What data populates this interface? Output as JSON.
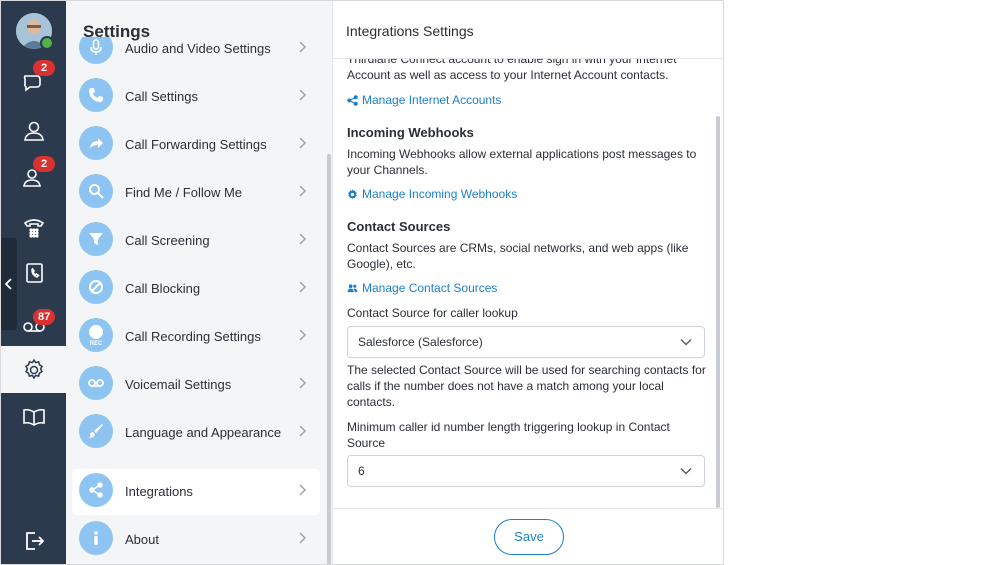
{
  "rail": {
    "chat_badge": "2",
    "contacts_badge": "2",
    "voicemail_badge": "87"
  },
  "menu": {
    "title": "Settings",
    "items": [
      {
        "label": "Audio and Video Settings",
        "icon": "microphone-icon"
      },
      {
        "label": "Call Settings",
        "icon": "phone-icon"
      },
      {
        "label": "Call Forwarding Settings",
        "icon": "forward-arrow-icon"
      },
      {
        "label": "Find Me / Follow Me",
        "icon": "search-icon"
      },
      {
        "label": "Call Screening",
        "icon": "funnel-icon"
      },
      {
        "label": "Call Blocking",
        "icon": "block-icon"
      },
      {
        "label": "Call Recording Settings",
        "icon": "record-icon",
        "icon_text": "REC"
      },
      {
        "label": "Voicemail Settings",
        "icon": "voicemail-icon"
      },
      {
        "label": "Language and Appearance",
        "icon": "brush-icon"
      },
      {
        "label": "Integrations",
        "icon": "share-icon",
        "selected": true
      },
      {
        "label": "About",
        "icon": "info-icon"
      }
    ]
  },
  "panel": {
    "title": "Integrations Settings",
    "intro_text": "Thirdlane Connect account to enable sign in with your Internet Account as well as access to your Internet Account contacts.",
    "manage_internet_accounts": "Manage Internet Accounts",
    "webhooks": {
      "heading": "Incoming Webhooks",
      "description": "Incoming Webhooks allow external applications post messages to your Channels.",
      "link": "Manage Incoming Webhooks"
    },
    "contact_sources": {
      "heading": "Contact Sources",
      "description": "Contact Sources are CRMs, social networks, and web apps (like Google), etc.",
      "link": "Manage Contact Sources",
      "lookup_label": "Contact Source for caller lookup",
      "lookup_value": "Salesforce (Salesforce)",
      "lookup_help": "The selected Contact Source will be used for searching contacts for calls if the number does not have a match among your local contacts.",
      "min_length_label": "Minimum caller id number length triggering lookup in Contact Source",
      "min_length_value": "6"
    },
    "save_label": "Save"
  },
  "colors": {
    "rail_bg": "#2b3a4d",
    "accent": "#1c7fd0",
    "icon_circle": "#8dc4f1",
    "badge": "#d9312f",
    "status_online": "#53b34b"
  }
}
